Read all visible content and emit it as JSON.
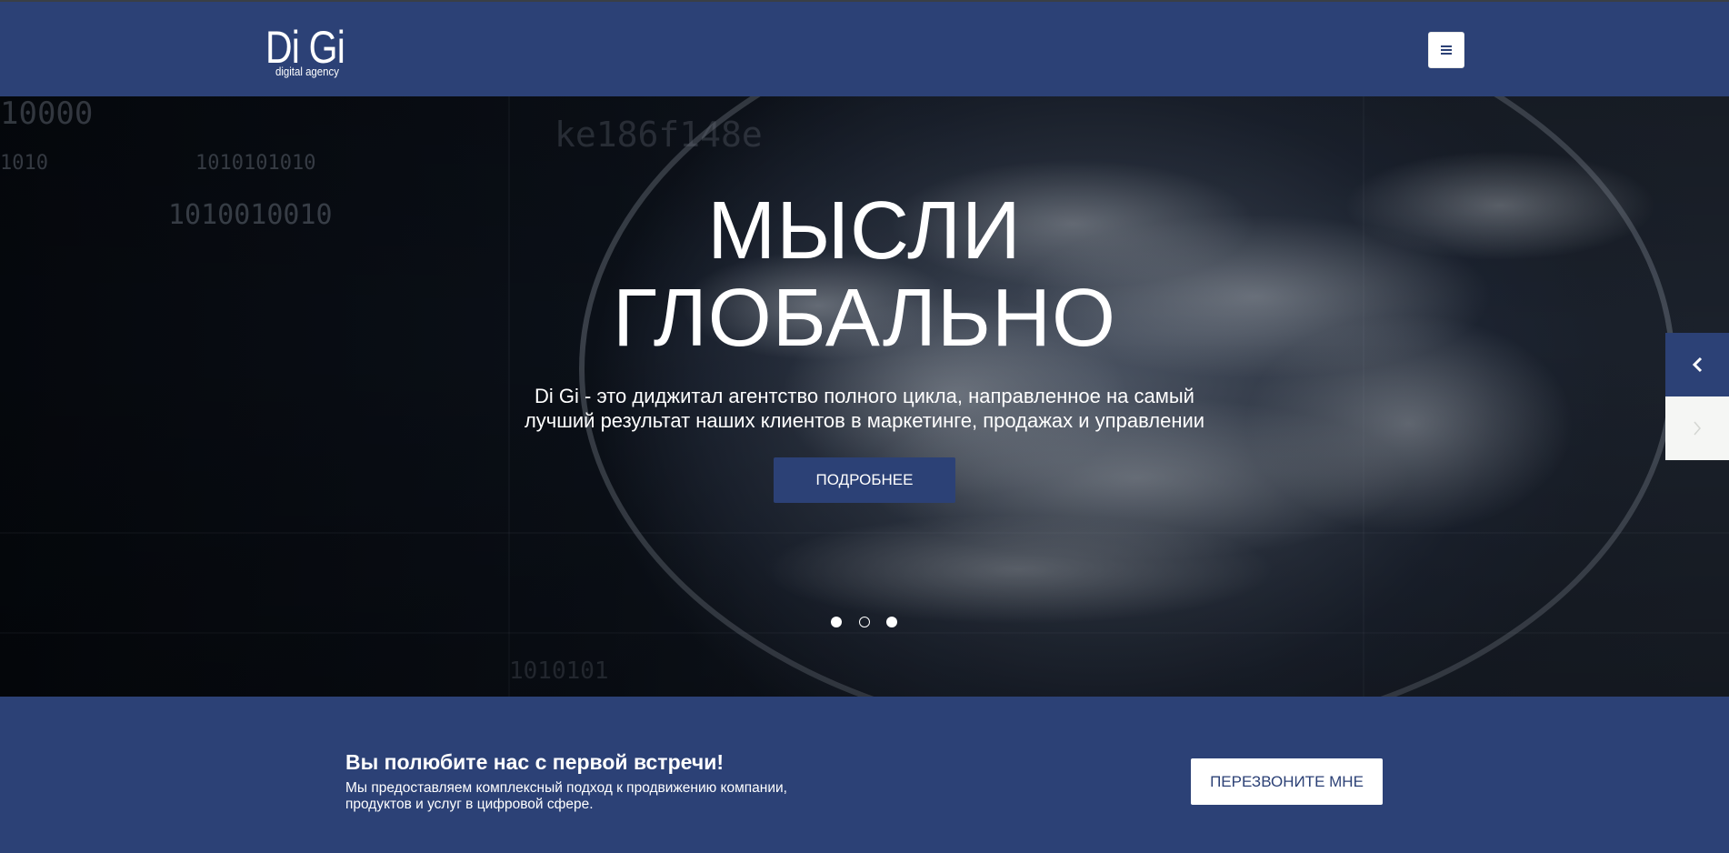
{
  "header": {
    "logo_name": "Di Gi",
    "logo_tagline": "digital agency",
    "menu_icon": "hamburger-icon"
  },
  "hero": {
    "title_line1": "МЫСЛИ",
    "title_line2": "ГЛОБАЛЬНО",
    "subtitle_line1": "Di Gi - это диджитал агентство полного цикла, направленное на самый",
    "subtitle_line2": "лучший результат наших клиентов в маркетинге, продажах и управлении",
    "button_label": "ПОДРОБНЕЕ",
    "background_digits": [
      "10000",
      "1010",
      "1010101010",
      "1010010010",
      "ke186f148e",
      "1010101"
    ],
    "slides": {
      "count": 3,
      "states": [
        "filled",
        "hollow",
        "filled"
      ]
    },
    "prev_icon": "chevron-left-icon",
    "next_icon": "chevron-right-icon"
  },
  "cta": {
    "title": "Вы полюбите нас с первой встречи!",
    "text_line1": "Мы предоставляем комплексный подход к продвижению компании,",
    "text_line2": "продуктов и услуг в цифровой сфере.",
    "button_label": "ПЕРЕЗВОНИТЕ МНЕ"
  },
  "colors": {
    "brand": "#2c4176",
    "white": "#ffffff",
    "hero_dark": "#0b1018"
  }
}
